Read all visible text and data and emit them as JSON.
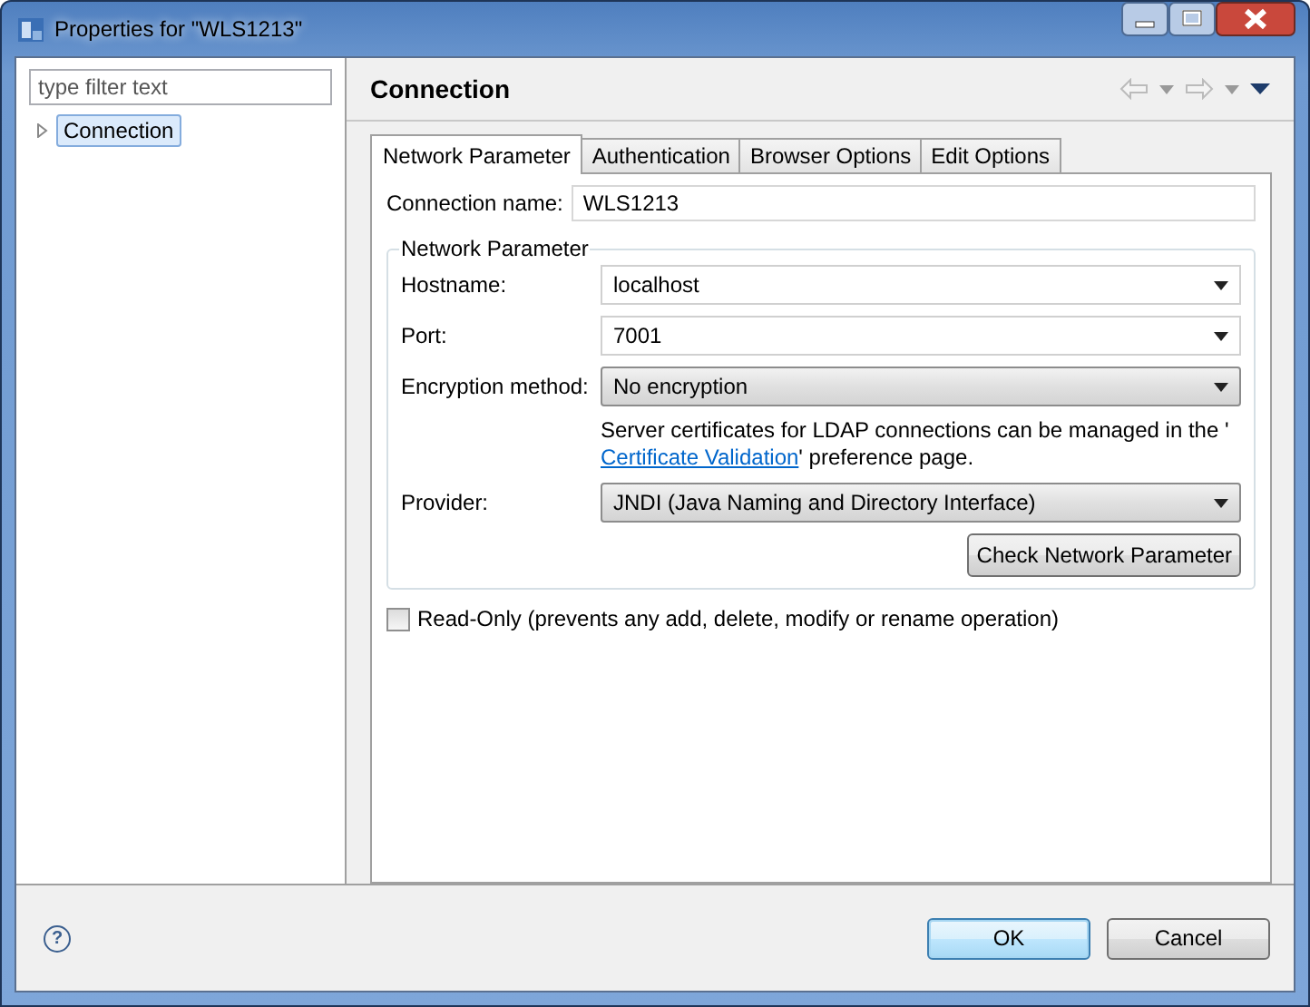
{
  "window": {
    "title": "Properties for \"WLS1213\""
  },
  "filter": {
    "placeholder": "type filter text"
  },
  "tree": [
    {
      "label": "Connection",
      "selected": true,
      "expanded": false
    }
  ],
  "page_title": "Connection",
  "tabs": [
    {
      "label": "Network Parameter",
      "selected": true
    },
    {
      "label": "Authentication",
      "selected": false
    },
    {
      "label": "Browser Options",
      "selected": false
    },
    {
      "label": "Edit Options",
      "selected": false
    }
  ],
  "connection_name": {
    "label": "Connection name:",
    "value": "WLS1213"
  },
  "group": {
    "title": "Network Parameter",
    "rows": [
      {
        "kind": "combo",
        "label": "Hostname:",
        "value": "localhost"
      },
      {
        "kind": "combo",
        "label": "Port:",
        "value": "7001"
      },
      {
        "kind": "select",
        "label": "Encryption method:",
        "value": "No encryption"
      },
      {
        "kind": "note",
        "text": "Server certificates for LDAP connections can be managed in the '",
        "link": "Certificate Validation",
        "after": "' preference page."
      },
      {
        "kind": "select",
        "label": "Provider:",
        "value": "JNDI (Java Naming and Directory Interface)"
      }
    ],
    "button": "Check Network Parameter"
  },
  "read_only": {
    "label": "Read-Only (prevents any add, delete, modify or rename operation)",
    "checked": false
  },
  "help": "?",
  "buttons": [
    {
      "label": "OK",
      "default": true
    },
    {
      "label": "Cancel",
      "default": false
    }
  ]
}
